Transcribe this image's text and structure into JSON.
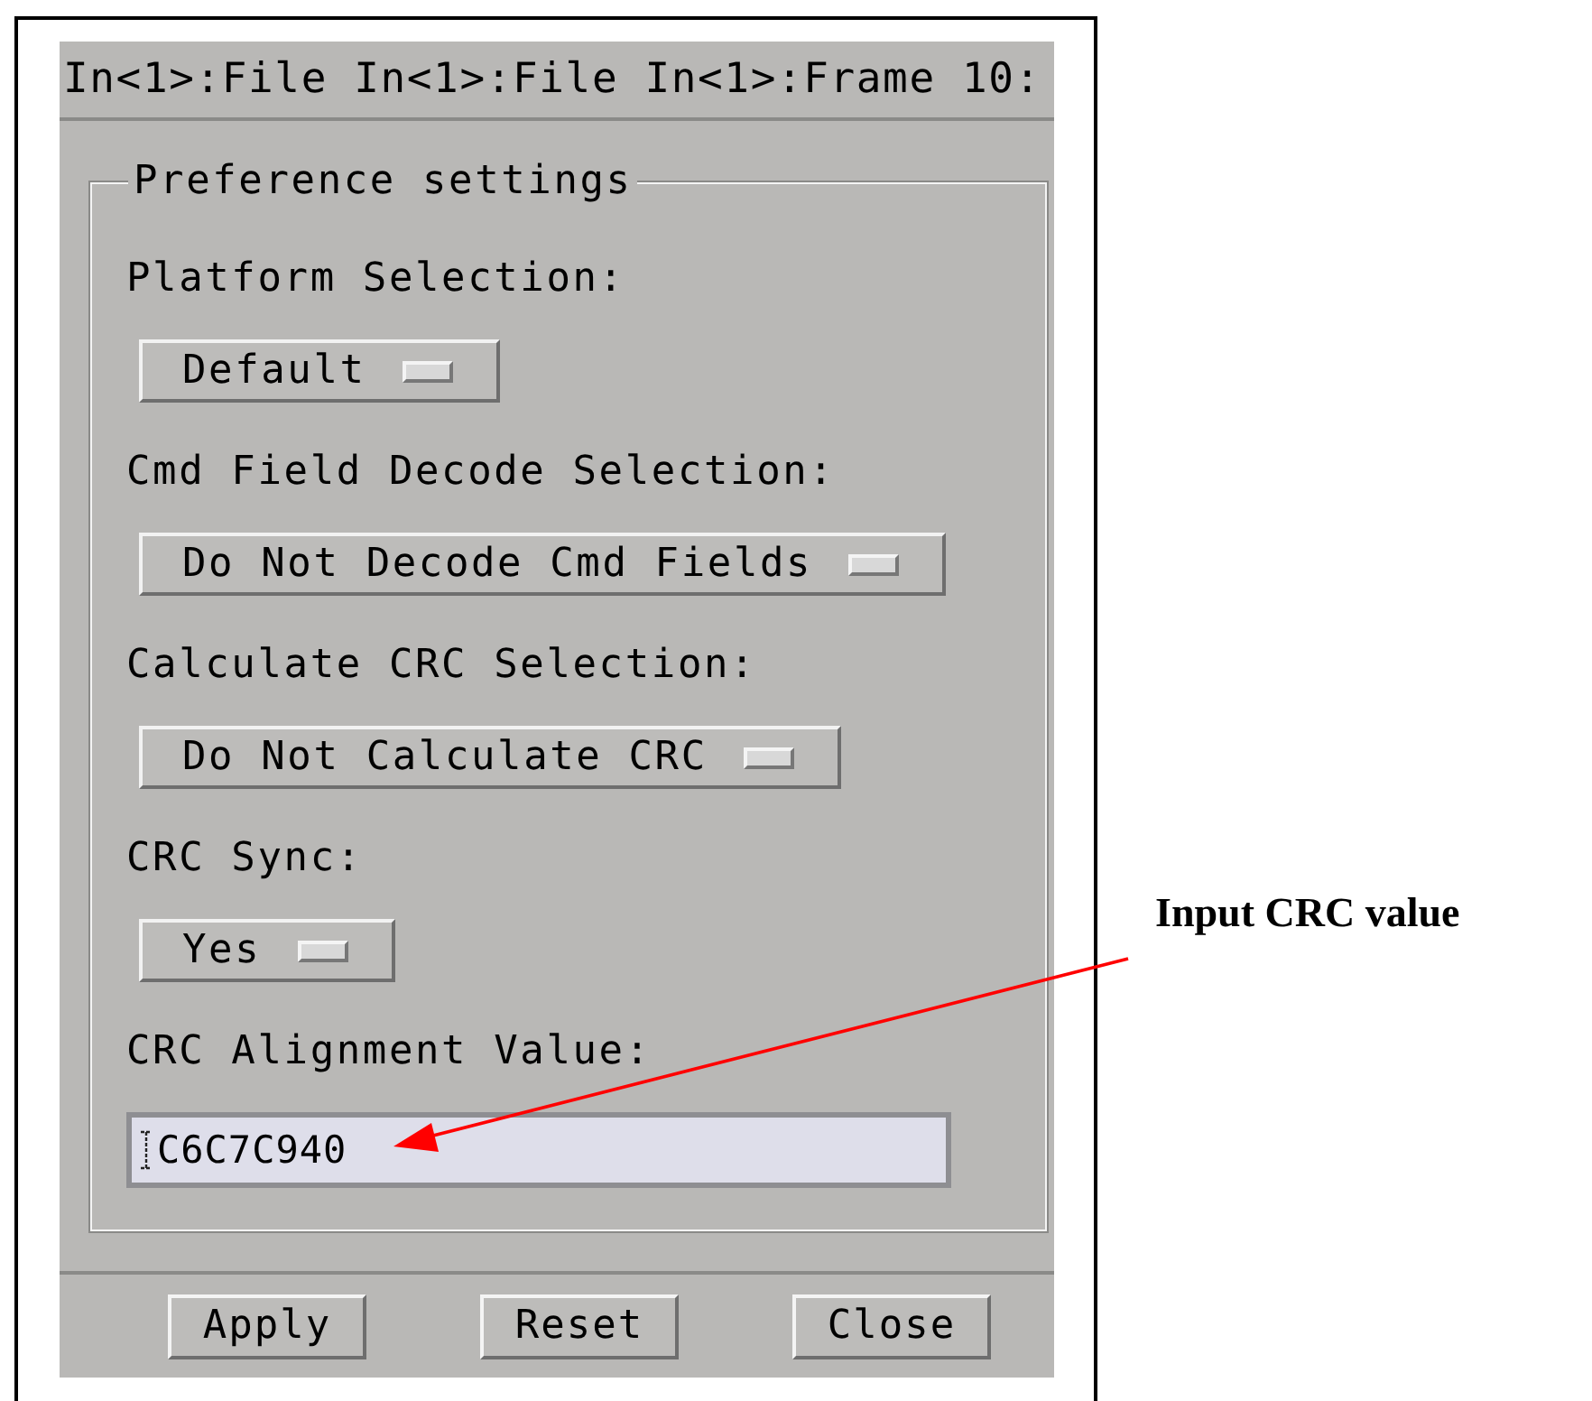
{
  "window": {
    "title": "In<1>:File In<1>:File In<1>:Frame 10:"
  },
  "group": {
    "title": "Preference settings",
    "settings": [
      {
        "kind": "option",
        "label": "Platform Selection:",
        "value": "Default"
      },
      {
        "kind": "option",
        "label": "Cmd Field Decode Selection:",
        "value": "Do Not Decode Cmd Fields"
      },
      {
        "kind": "option",
        "label": "Calculate CRC Selection:",
        "value": "Do Not Calculate CRC"
      },
      {
        "kind": "option",
        "label": "CRC Sync:",
        "value": "Yes"
      },
      {
        "kind": "text",
        "label": "CRC Alignment Value:",
        "value": "C6C7C940"
      }
    ]
  },
  "buttons": [
    "Apply",
    "Reset",
    "Close"
  ],
  "annotation": {
    "text": "Input CRC value"
  }
}
